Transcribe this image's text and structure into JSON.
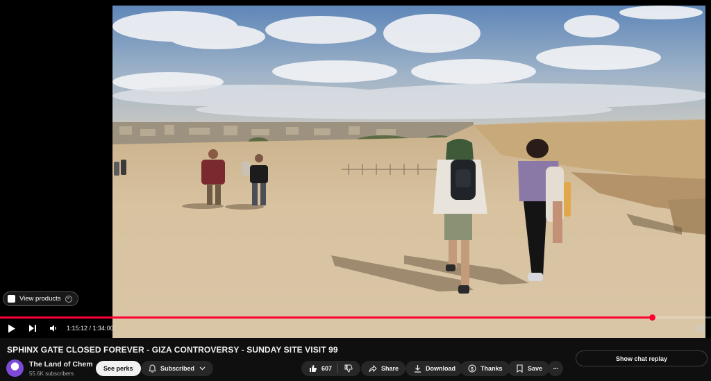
{
  "player": {
    "view_products_label": "View products",
    "progress_fraction": 0.917,
    "current_time": "1:15:12",
    "duration": "1:34:00",
    "time_separator": " / "
  },
  "video": {
    "title": "SPHINX GATE CLOSED FOREVER - GIZA CONTROVERSY - SUNDAY SITE VISIT 99"
  },
  "channel": {
    "name": "The Land of Chem",
    "subscribers": "55.6K subscribers",
    "perks_label": "See perks",
    "subscribed_label": "Subscribed"
  },
  "actions": {
    "like_count": "607",
    "share_label": "Share",
    "download_label": "Download",
    "thanks_label": "Thanks",
    "save_label": "Save",
    "more_label": "···"
  },
  "chat": {
    "show_replay_label": "Show chat replay"
  },
  "colors": {
    "accent": "#ff0033",
    "background": "#0f0f0f",
    "pill": "#272727"
  },
  "icons": [
    "play-icon",
    "next-icon",
    "volume-icon",
    "close-icon",
    "bell-icon",
    "chevron-down-icon",
    "like-icon",
    "dislike-icon",
    "share-icon",
    "download-icon",
    "thanks-icon",
    "save-icon",
    "more-icon",
    "subtitles-icon"
  ]
}
